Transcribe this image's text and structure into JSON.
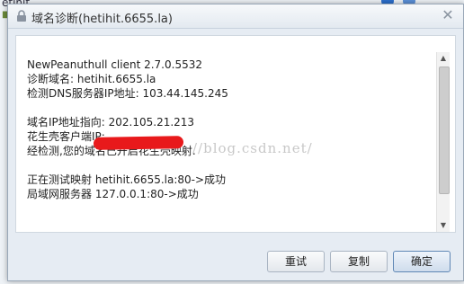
{
  "background": {
    "fragment_text": "etihit"
  },
  "window": {
    "title": "域名诊断(hetihit.6655.la)",
    "close_symbol": "✕"
  },
  "report": {
    "lines": [
      "NewPeanuthull client 2.7.0.5532",
      "诊断域名: hetihit.6655.la",
      "检测DNS服务器IP地址: 103.44.145.245",
      "",
      "域名IP地址指向: 202.105.21.213",
      "花生壳客户端IP:",
      "经检测,您的域名已开启花生壳映射.",
      "",
      "正在测试映射 hetihit.6655.la:80->成功",
      "局域网服务器 127.0.0.1:80->成功"
    ],
    "watermark": "//blog.csdn.net/"
  },
  "scrollbar": {
    "up_arrow": "▲",
    "down_arrow": "▼"
  },
  "buttons": {
    "retry": "重试",
    "copy": "复制",
    "ok": "确定"
  },
  "colors": {
    "redaction": "#e8191b",
    "primary_button_border": "#5f87b5"
  }
}
